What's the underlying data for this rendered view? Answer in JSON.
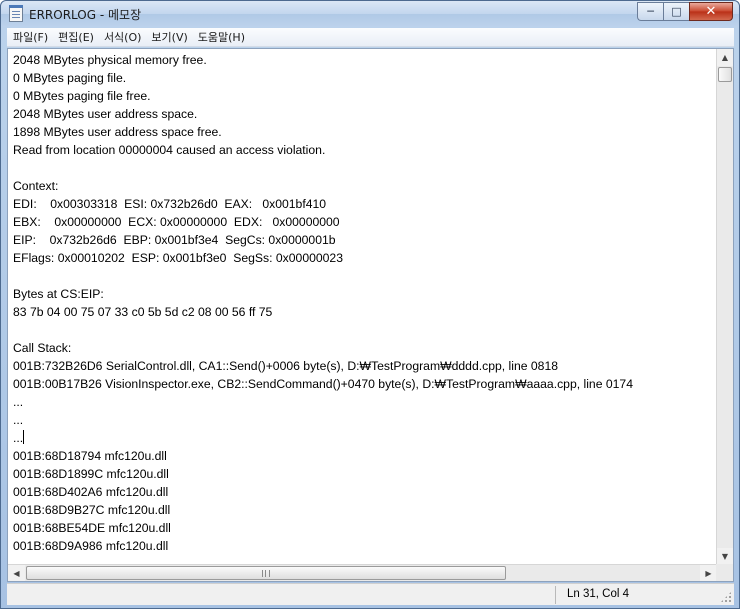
{
  "window": {
    "title": "ERRORLOG - 메모장",
    "minimize_glyph": "─",
    "maximize_glyph": "□",
    "close_glyph": "✕"
  },
  "menu": {
    "items": [
      {
        "label": "파일(F)"
      },
      {
        "label": "편집(E)"
      },
      {
        "label": "서식(O)"
      },
      {
        "label": "보기(V)"
      },
      {
        "label": "도움말(H)"
      }
    ]
  },
  "document": {
    "lines": [
      "2048 MBytes physical memory free.",
      "0 MBytes paging file.",
      "0 MBytes paging file free.",
      "2048 MBytes user address space.",
      "1898 MBytes user address space free.",
      "Read from location 00000004 caused an access violation.",
      "",
      "Context:",
      "EDI:    0x00303318  ESI: 0x732b26d0  EAX:   0x001bf410",
      "EBX:    0x00000000  ECX: 0x00000000  EDX:   0x00000000",
      "EIP:    0x732b26d6  EBP: 0x001bf3e4  SegCs: 0x0000001b",
      "EFlags: 0x00010202  ESP: 0x001bf3e0  SegSs: 0x00000023",
      "",
      "Bytes at CS:EIP:",
      "83 7b 04 00 75 07 33 c0 5b 5d c2 08 00 56 ff 75",
      "",
      "Call Stack:",
      "001B:732B26D6 SerialControl.dll, CA1::Send()+0006 byte(s), D:₩TestProgram₩dddd.cpp, line 0818",
      "001B:00B17B26 VisionInspector.exe, CB2::SendCommand()+0470 byte(s), D:₩TestProgram₩aaaa.cpp, line 0174",
      "...",
      "...",
      "...",
      "001B:68D18794 mfc120u.dll",
      "001B:68D1899C mfc120u.dll",
      "001B:68D402A6 mfc120u.dll",
      "001B:68D9B27C mfc120u.dll",
      "001B:68BE54DE mfc120u.dll",
      "001B:68D9A986 mfc120u.dll"
    ]
  },
  "status": {
    "position": "Ln 31, Col 4"
  },
  "colors": {
    "titlebar": "#c2d6ee",
    "close_button": "#c9462c",
    "editor_background": "#ffffff"
  }
}
